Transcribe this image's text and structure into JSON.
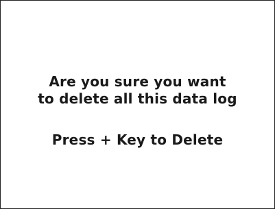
{
  "dialog": {
    "message_line_1": "Are you sure you want",
    "message_line_2": "to delete all this data log",
    "instruction": "Press + Key to Delete"
  }
}
